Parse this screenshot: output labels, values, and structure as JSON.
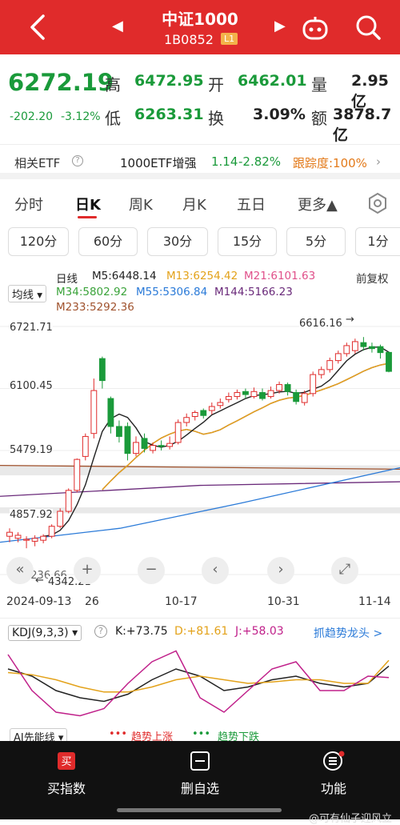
{
  "header": {
    "title": "中证1000",
    "code": "1B0852",
    "level_tag": "L1"
  },
  "quote": {
    "price": "6272.19",
    "change": "-202.20",
    "change_pct": "-3.12%",
    "high_label": "高",
    "high": "6472.95",
    "open_label": "开",
    "open": "6462.01",
    "volume_label": "量",
    "volume": "2.95亿",
    "low_label": "低",
    "low": "6263.31",
    "turnover_label": "换",
    "turnover": "3.09%",
    "amount_label": "额",
    "amount": "3878.7亿"
  },
  "etf": {
    "label": "相关ETF",
    "name": "1000ETF增强",
    "price": "1.14",
    "change_pct": "-2.82%",
    "tracking": "跟踪度:100%"
  },
  "tabs": [
    "分时",
    "日K",
    "周K",
    "月K",
    "五日",
    "更多▲"
  ],
  "periods": [
    "120分",
    "60分",
    "30分",
    "15分",
    "5分",
    "1分"
  ],
  "chart": {
    "line_label": "日线",
    "ma_mode": "均线",
    "adjust": "前复权",
    "ma": [
      {
        "text": "M5:6448.14",
        "color": "#222222"
      },
      {
        "text": "M13:6254.42",
        "color": "#e3a21a"
      },
      {
        "text": "M21:6101.63",
        "color": "#e0508a"
      },
      {
        "text": "M34:5802.92",
        "color": "#3aa33a"
      },
      {
        "text": "M55:5306.84",
        "color": "#2a7ad8"
      },
      {
        "text": "M144:5166.23",
        "color": "#6a2a7a"
      },
      {
        "text": "M233:5292.36",
        "color": "#a0522d"
      }
    ],
    "y_labels": [
      "6721.71",
      "6100.45",
      "5479.19",
      "4857.92",
      "4236.66"
    ],
    "x_labels": [
      "2024-09-13",
      "26",
      "10-17",
      "10-31",
      "11-14"
    ],
    "max_marker": "6616.16",
    "min_marker": "4342.21"
  },
  "chart_data": {
    "type": "candlestick",
    "ylim": [
      4236.66,
      6721.71
    ],
    "candles": [
      [
        4620,
        4660,
        4560,
        4700
      ],
      [
        4600,
        4630,
        4560,
        4660
      ],
      [
        4580,
        4590,
        4500,
        4620
      ],
      [
        4570,
        4600,
        4520,
        4630
      ],
      [
        4580,
        4620,
        4550,
        4640
      ],
      [
        4620,
        4720,
        4600,
        4740
      ],
      [
        4720,
        4870,
        4700,
        4900
      ],
      [
        4870,
        5080,
        4850,
        5100
      ],
      [
        5080,
        5390,
        5060,
        5400
      ],
      [
        5420,
        5620,
        5380,
        5650
      ],
      [
        5650,
        6080,
        5600,
        6200
      ],
      [
        6400,
        6180,
        6100,
        6420
      ],
      [
        6000,
        5720,
        5650,
        6020
      ],
      [
        5720,
        5620,
        5560,
        5780
      ],
      [
        5720,
        5450,
        5380,
        5760
      ],
      [
        5450,
        5560,
        5420,
        5620
      ],
      [
        5600,
        5500,
        5460,
        5650
      ],
      [
        5480,
        5530,
        5450,
        5560
      ],
      [
        5530,
        5520,
        5480,
        5580
      ],
      [
        5520,
        5550,
        5490,
        5620
      ],
      [
        5560,
        5760,
        5540,
        5790
      ],
      [
        5760,
        5810,
        5720,
        5850
      ],
      [
        5820,
        5860,
        5780,
        5880
      ],
      [
        5880,
        5830,
        5800,
        5900
      ],
      [
        5880,
        5920,
        5840,
        5960
      ],
      [
        5930,
        5960,
        5900,
        6000
      ],
      [
        5990,
        6020,
        5960,
        6060
      ],
      [
        6020,
        6060,
        5990,
        6090
      ],
      [
        6070,
        6040,
        6000,
        6100
      ],
      [
        6020,
        6070,
        6000,
        6110
      ],
      [
        6060,
        6000,
        5980,
        6100
      ],
      [
        6020,
        6080,
        6000,
        6120
      ],
      [
        6080,
        6140,
        6050,
        6170
      ],
      [
        6140,
        6070,
        6030,
        6160
      ],
      [
        6060,
        5970,
        5940,
        6090
      ],
      [
        5960,
        6050,
        5930,
        6080
      ],
      [
        6050,
        6240,
        6020,
        6270
      ],
      [
        6240,
        6290,
        6200,
        6320
      ],
      [
        6290,
        6380,
        6260,
        6410
      ],
      [
        6380,
        6450,
        6350,
        6480
      ],
      [
        6450,
        6530,
        6420,
        6560
      ],
      [
        6480,
        6570,
        6450,
        6600
      ],
      [
        6560,
        6520,
        6480,
        6616
      ],
      [
        6520,
        6500,
        6460,
        6560
      ],
      [
        6520,
        6460,
        6400,
        6540
      ],
      [
        6462,
        6272,
        6263,
        6473
      ]
    ]
  },
  "controls": {
    "zoom_in": "+",
    "zoom_out": "−",
    "prev": "‹",
    "next": "›",
    "fullscreen": "⤢"
  },
  "kdj": {
    "name": "KDJ(9,3,3)",
    "k": "K:+73.75",
    "d": "D:+81.61",
    "j": "J:+58.03",
    "signal": "抓趋势龙头 >"
  },
  "ai": {
    "label": "AI先能线",
    "up": "趋势上涨",
    "down": "趋势下跌"
  },
  "bottom_nav": [
    {
      "label": "买指数"
    },
    {
      "label": "删自选"
    },
    {
      "label": "功能"
    }
  ],
  "watermark": "@可有仙子迎风立",
  "colors": {
    "up": "#e02b2b",
    "down": "#1a9a3a",
    "brand": "#e02b2b"
  }
}
